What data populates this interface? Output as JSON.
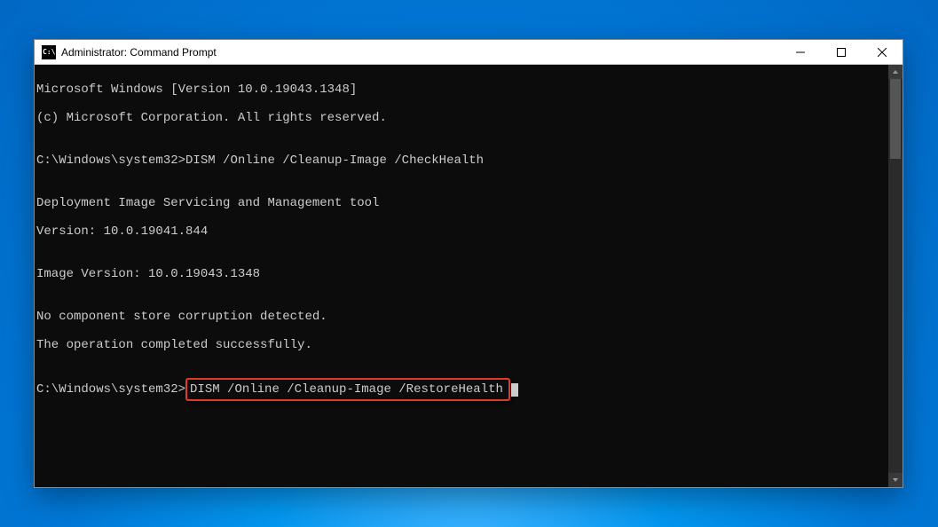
{
  "window": {
    "title": "Administrator: Command Prompt"
  },
  "terminal": {
    "line1": "Microsoft Windows [Version 10.0.19043.1348]",
    "line2": "(c) Microsoft Corporation. All rights reserved.",
    "blank1": "",
    "prompt1": "C:\\Windows\\system32>",
    "cmd1": "DISM /Online /Cleanup-Image /CheckHealth",
    "blank2": "",
    "out1": "Deployment Image Servicing and Management tool",
    "out2": "Version: 10.0.19041.844",
    "blank3": "",
    "out3": "Image Version: 10.0.19043.1348",
    "blank4": "",
    "out4": "No component store corruption detected.",
    "out5": "The operation completed successfully.",
    "blank5": "",
    "prompt2": "C:\\Windows\\system32>",
    "cmd2": "DISM /Online /Cleanup-Image /RestoreHealth"
  },
  "colors": {
    "desktop": "#0178d7",
    "terminal_bg": "#0c0c0c",
    "terminal_fg": "#cccccc",
    "highlight_border": "#e03a2f"
  }
}
